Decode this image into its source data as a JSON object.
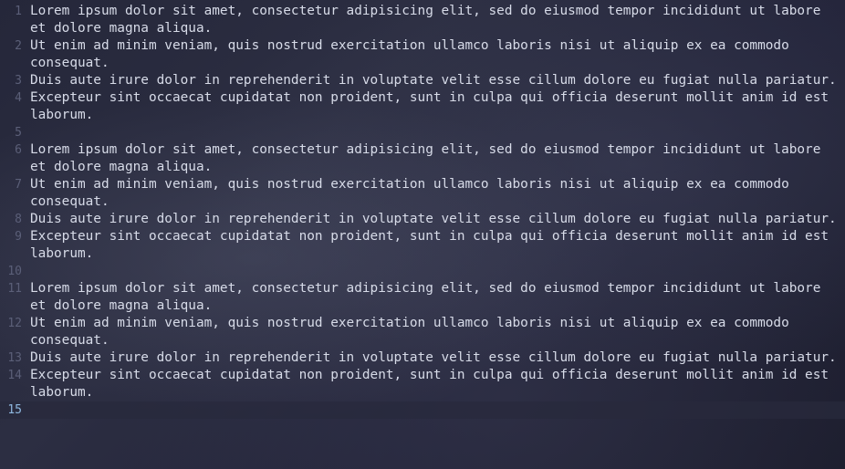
{
  "editor": {
    "current_line": "15",
    "lines": [
      {
        "num": "1",
        "text": "Lorem ipsum dolor sit amet, consectetur adipisicing elit, sed do eiusmod tempor incididunt ut labore et dolore magna aliqua."
      },
      {
        "num": "2",
        "text": "Ut enim ad minim veniam, quis nostrud exercitation ullamco laboris nisi ut aliquip ex ea commodo consequat."
      },
      {
        "num": "3",
        "text": "Duis aute irure dolor in reprehenderit in voluptate velit esse cillum dolore eu fugiat nulla pariatur."
      },
      {
        "num": "4",
        "text": "Excepteur sint occaecat cupidatat non proident, sunt in culpa qui officia deserunt mollit anim id est laborum."
      },
      {
        "num": "5",
        "text": ""
      },
      {
        "num": "6",
        "text": "Lorem ipsum dolor sit amet, consectetur adipisicing elit, sed do eiusmod tempor incididunt ut labore et dolore magna aliqua."
      },
      {
        "num": "7",
        "text": "Ut enim ad minim veniam, quis nostrud exercitation ullamco laboris nisi ut aliquip ex ea commodo consequat."
      },
      {
        "num": "8",
        "text": "Duis aute irure dolor in reprehenderit in voluptate velit esse cillum dolore eu fugiat nulla pariatur."
      },
      {
        "num": "9",
        "text": "Excepteur sint occaecat cupidatat non proident, sunt in culpa qui officia deserunt mollit anim id est laborum."
      },
      {
        "num": "10",
        "text": ""
      },
      {
        "num": "11",
        "text": "Lorem ipsum dolor sit amet, consectetur adipisicing elit, sed do eiusmod tempor incididunt ut labore et dolore magna aliqua."
      },
      {
        "num": "12",
        "text": "Ut enim ad minim veniam, quis nostrud exercitation ullamco laboris nisi ut aliquip ex ea commodo consequat."
      },
      {
        "num": "13",
        "text": "Duis aute irure dolor in reprehenderit in voluptate velit esse cillum dolore eu fugiat nulla pariatur."
      },
      {
        "num": "14",
        "text": "Excepteur sint occaecat cupidatat non proident, sunt in culpa qui officia deserunt mollit anim id est laborum."
      },
      {
        "num": "15",
        "text": ""
      }
    ]
  },
  "colors": {
    "text": "#d7dbe8",
    "line_number": "#5b5f78",
    "current_line_number": "#8fb8e0",
    "background": "#23243a"
  }
}
